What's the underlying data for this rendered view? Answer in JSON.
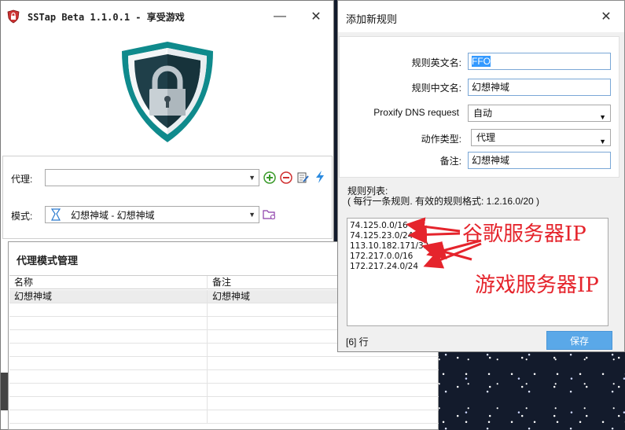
{
  "main_window": {
    "title": "SSTap Beta 1.1.0.1 - 享受游戏",
    "minimize_glyph": "—",
    "close_glyph": "✕"
  },
  "form": {
    "proxy_label": "代理:",
    "proxy_value": "",
    "mode_label": "模式:",
    "mode_value": "幻想神域 - 幻想神域"
  },
  "manage": {
    "title": "代理模式管理",
    "columns": [
      "名称",
      "备注"
    ],
    "rows": [
      {
        "name": "幻想神域",
        "note": "幻想神域"
      }
    ]
  },
  "dialog": {
    "title": "添加新规则",
    "close_glyph": "✕",
    "en_name_label": "规则英文名:",
    "en_name_value": "FFO",
    "cn_name_label": "规则中文名:",
    "cn_name_value": "幻想神域",
    "dns_label": "Proxify DNS request",
    "dns_value": "自动",
    "action_label": "动作类型:",
    "action_value": "代理",
    "note_label": "备注:",
    "note_value": "幻想神域",
    "rules_label": "规则列表:",
    "rules_hint": "( 每行一条规则. 有效的规则格式: 1.2.16.0/20 )",
    "rules": [
      "74.125.0.0/16",
      "74.125.23.0/24",
      "113.10.182.171/32",
      "172.217.0.0/16",
      "172.217.24.0/24"
    ],
    "line_count": "[6] 行",
    "save_label": "保存"
  },
  "annotations": {
    "google": "谷歌服务器IP",
    "game": "游戏服务器IP",
    "color": "#e5242c"
  },
  "icons": [
    "lock-shield-icon",
    "add-icon",
    "remove-icon",
    "edit-icon",
    "lightning-icon",
    "mode-icon",
    "folder-icon"
  ]
}
